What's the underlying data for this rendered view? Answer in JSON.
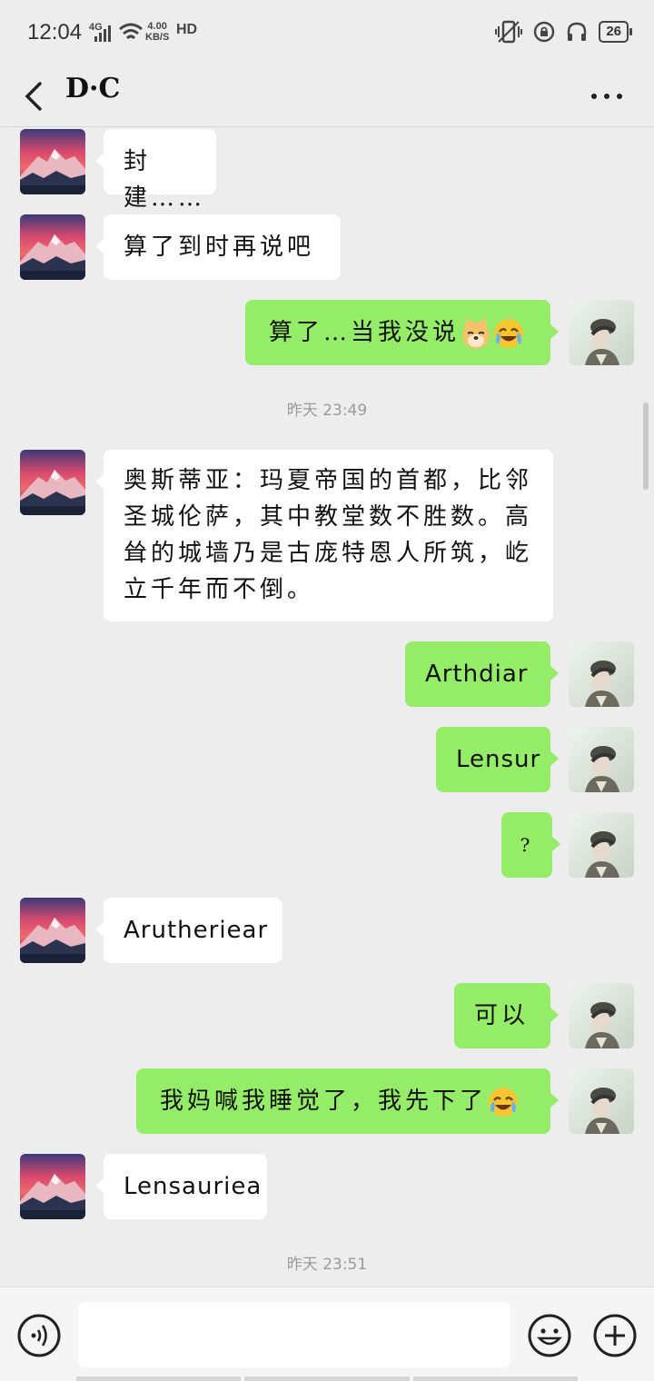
{
  "status_bar": {
    "time": "12:04",
    "network": "4G",
    "speed_value": "4.00",
    "speed_unit": "KB/S",
    "hd": "HD",
    "battery": "26",
    "icons": [
      "signal-icon",
      "wifi-icon",
      "vibrate-icon",
      "lock-rotation-icon",
      "headphones-icon",
      "battery-icon"
    ]
  },
  "header": {
    "title": "D·C",
    "back_icon": "chevron-left-icon",
    "more_icon": "more-dots-icon"
  },
  "messages": [
    {
      "side": "left",
      "text": "封建……"
    },
    {
      "side": "left",
      "text": "算了到时再说吧"
    },
    {
      "side": "right",
      "text": "算了…当我没说",
      "emojis": [
        "doge-emoji",
        "laugh-cry-emoji"
      ]
    },
    {
      "type": "time",
      "text": "昨天 23:49"
    },
    {
      "side": "left",
      "text": "奥斯蒂亚：玛夏帝国的首都，比邻圣城伦萨，其中教堂数不胜数。高耸的城墙乃是古庞特恩人所筑，屹立千年而不倒。"
    },
    {
      "side": "right",
      "text": "Arthdiar"
    },
    {
      "side": "right",
      "text": "Lensur"
    },
    {
      "side": "right",
      "text": "?"
    },
    {
      "side": "left",
      "text": "Arutheriear"
    },
    {
      "side": "right",
      "text": "可以"
    },
    {
      "side": "right",
      "text": "我妈喊我睡觉了，我先下了",
      "emojis": [
        "laugh-cry-emoji"
      ]
    },
    {
      "side": "left",
      "text": "Lensauriea"
    },
    {
      "type": "time",
      "text": "昨天 23:51"
    }
  ],
  "input_bar": {
    "voice_icon": "voice-icon",
    "emoji_icon": "emoji-face-icon",
    "plus_icon": "plus-icon",
    "placeholder": ""
  }
}
